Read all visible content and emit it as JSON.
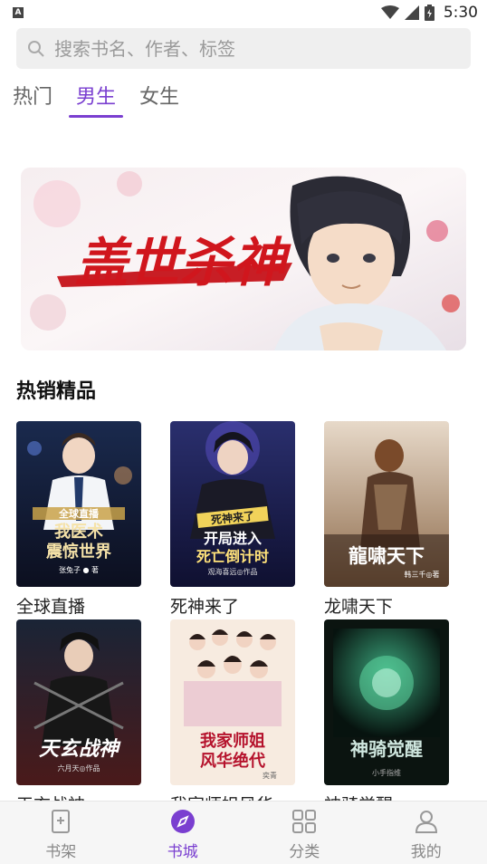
{
  "status_bar": {
    "app_badge": "A",
    "time": "5:30"
  },
  "search": {
    "placeholder": "搜索书名、作者、标签"
  },
  "tabs": [
    {
      "label": "热门",
      "active": false
    },
    {
      "label": "男生",
      "active": true
    },
    {
      "label": "女生",
      "active": false
    }
  ],
  "banner": {
    "title_art": "盖世杀神"
  },
  "section": {
    "title": "热销精品"
  },
  "books": [
    {
      "cover_text": "我医术震惊世界",
      "cover_top": "全球直播",
      "author": "张兔子 ● 著",
      "title": "全球直播"
    },
    {
      "cover_text": "开局进入死亡倒计时",
      "cover_top": "死神来了",
      "author": "观海喜远◎作品",
      "title": "死神来了"
    },
    {
      "cover_text": "龙啸天下",
      "cover_top": "",
      "author": "韩三千◎著",
      "title": "龙啸天下"
    },
    {
      "cover_text": "天玄战神",
      "cover_top": "",
      "author": "六月天◎作品",
      "title": "天玄战神"
    },
    {
      "cover_text": "我家师姐风华绝代",
      "cover_top": "",
      "author": "奕青",
      "title": "我家师姐风华"
    },
    {
      "cover_text": "神骑觉醒",
      "cover_top": "",
      "author": "小手指维",
      "title": "神骑觉醒"
    }
  ],
  "bottom_nav": [
    {
      "label": "书架",
      "icon": "bookshelf-icon",
      "active": false
    },
    {
      "label": "书城",
      "icon": "compass-icon",
      "active": true
    },
    {
      "label": "分类",
      "icon": "grid-icon",
      "active": false
    },
    {
      "label": "我的",
      "icon": "user-icon",
      "active": false
    }
  ],
  "colors": {
    "accent": "#7a3fd0",
    "search_bg": "#efefef",
    "nav_bg": "#f6f6f6"
  }
}
